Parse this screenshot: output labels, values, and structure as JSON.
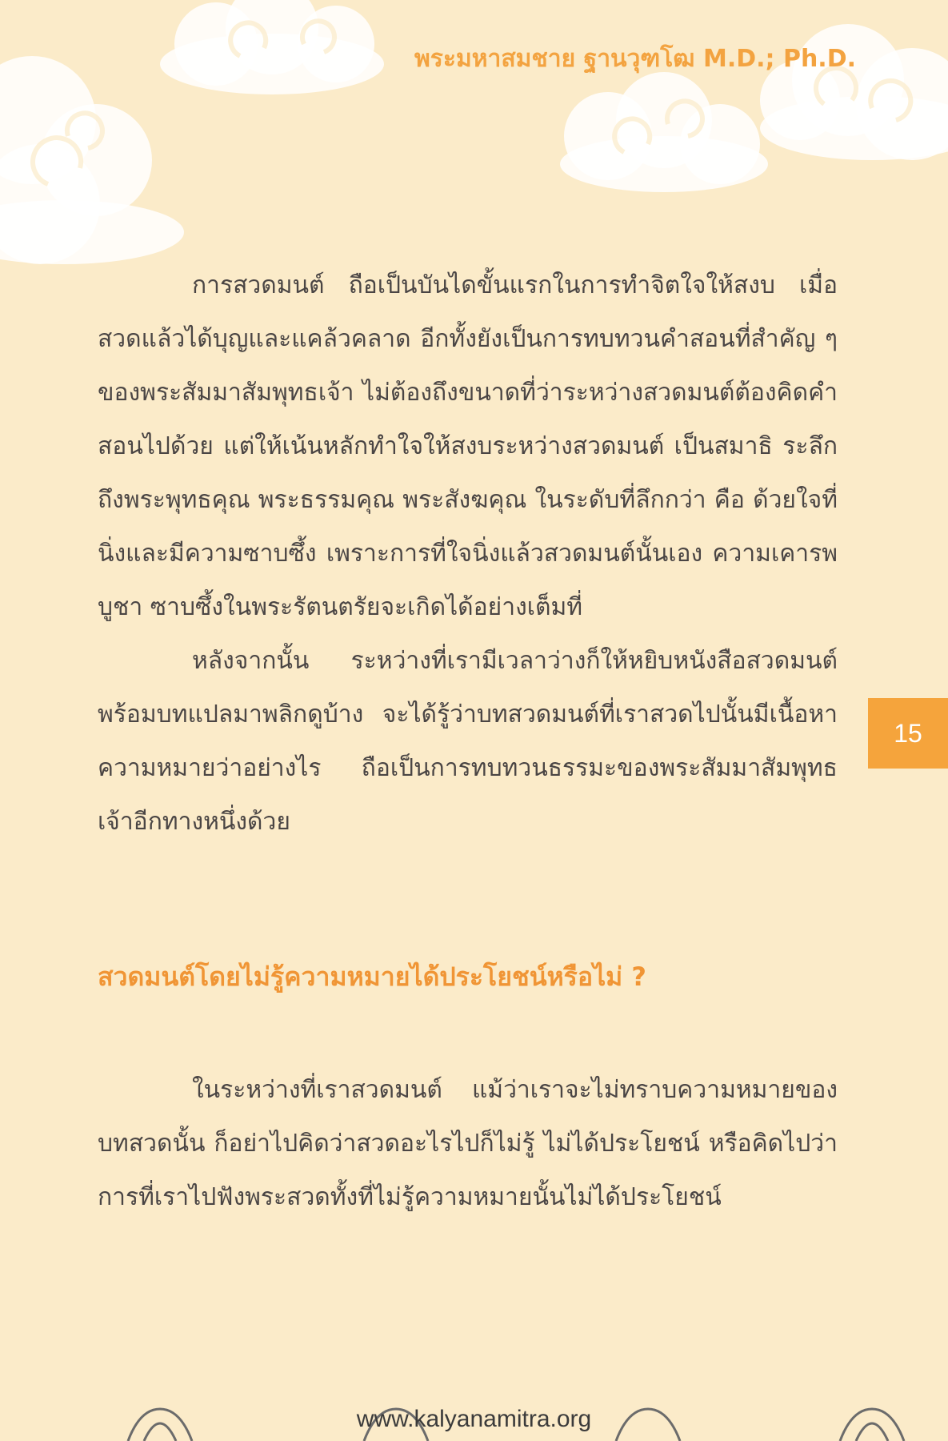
{
  "header": {
    "running_title": "พระมหาสมชาย ฐานวุฑโฒ M.D.; Ph.D."
  },
  "page_number": "15",
  "paragraphs_top": [
    "การสวดมนต์ ถือเป็นบันไดขั้นแรกในการทำจิตใจให้สงบ เมื่อสวดแล้วได้บุญและแคล้วคลาด อีกทั้งยังเป็นการทบทวนคำสอนที่สำคัญ ๆ ของพระสัมมาสัมพุทธเจ้า ไม่ต้องถึงขนาดที่ว่าระหว่างสวดมนต์ต้องคิดคำสอนไปด้วย แต่ให้เน้นหลักทำใจให้สงบระหว่างสวดมนต์ เป็นสมาธิ ระลึกถึงพระพุทธคุณ พระธรรมคุณ พระสังฆคุณ ในระดับที่ลึกกว่า คือ ด้วยใจที่นิ่งและมีความซาบซึ้ง เพราะการที่ใจนิ่งแล้วสวดมนต์นั้นเอง ความเคารพบูชา ซาบซึ้งในพระรัตนตรัยจะเกิดได้อย่างเต็มที่",
    "หลังจากนั้น ระหว่างที่เรามีเวลาว่างก็ให้หยิบหนังสือสวดมนต์พร้อมบทแปลมาพลิกดูบ้าง จะได้รู้ว่าบทสวดมนต์ที่เราสวดไปนั้นมีเนื้อหาความหมายว่าอย่างไร ถือเป็นการทบทวนธรรมะของพระสัมมาสัมพุทธเจ้าอีกทางหนึ่งด้วย"
  ],
  "section": {
    "heading": "สวดมนต์โดยไม่รู้ความหมายได้ประโยชน์หรือไม่ ?",
    "paragraphs": [
      "ในระหว่างที่เราสวดมนต์ แม้ว่าเราจะไม่ทราบความหมายของบทสวดนั้น ก็อย่าไปคิดว่าสวดอะไรไปก็ไม่รู้ ไม่ได้ประโยชน์ หรือคิดไปว่า การที่เราไปฟังพระสวดทั้งที่ไม่รู้ความหมายนั้นไม่ได้ประโยชน์"
    ]
  },
  "footer": {
    "url": "www.kalyanamitra.org"
  },
  "colors": {
    "background": "#fbebc9",
    "accent": "#f5a43c",
    "heading": "#f09535",
    "text": "#4a4544",
    "cloud": "#ffffff"
  }
}
